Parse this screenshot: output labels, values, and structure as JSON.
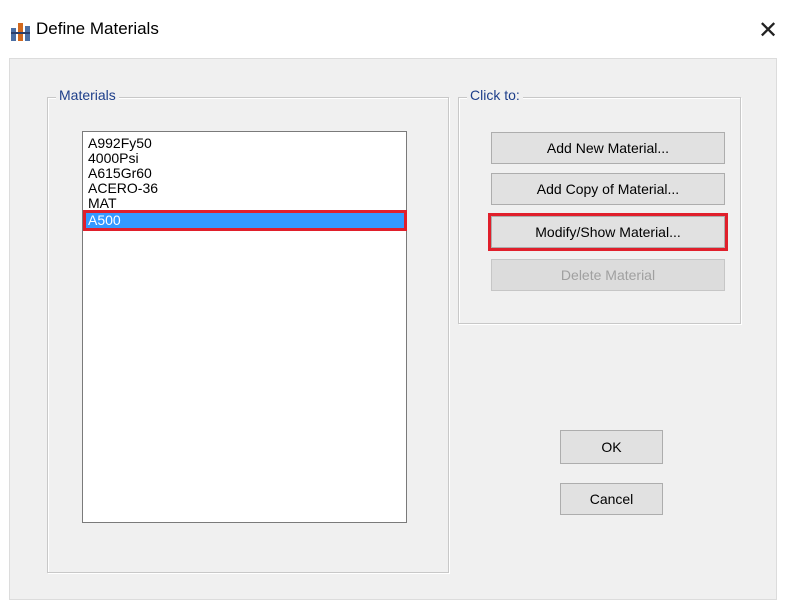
{
  "window": {
    "title": "Define Materials",
    "close_symbol": "✕"
  },
  "materials_group": {
    "label": "Materials",
    "items": [
      "A992Fy50",
      "4000Psi",
      "A615Gr60",
      "ACERO-36",
      "MAT",
      "A500"
    ],
    "selected_index": 5
  },
  "click_to_group": {
    "label": "Click to:",
    "add_new_label": "Add New Material...",
    "add_copy_label": "Add Copy of Material...",
    "modify_show_label": "Modify/Show Material...",
    "delete_label": "Delete Material"
  },
  "buttons": {
    "ok_label": "OK",
    "cancel_label": "Cancel"
  },
  "colors": {
    "selection": "#3399ff",
    "highlight_box": "#e01f2b",
    "group_label": "#1d3e8a"
  }
}
